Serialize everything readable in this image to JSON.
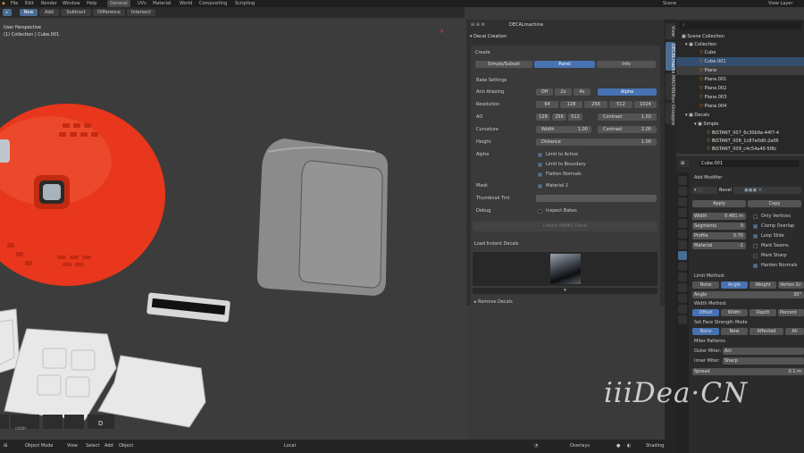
{
  "menu": [
    "File",
    "Edit",
    "Render",
    "Window",
    "Help"
  ],
  "workspaces": [
    "General",
    "UVs",
    "Material",
    "World",
    "Compositing",
    "Scripting"
  ],
  "scene_label": "Scene",
  "view_layer_label": "View Layer",
  "toolbar": {
    "new": "New",
    "add": "Add",
    "subtract": "Subtract",
    "difference": "Difference",
    "intersect": "Intersect"
  },
  "viewport": {
    "perspective": "User Perspective",
    "collection": "(1) Collection | Cube.001",
    "bottom_text": "cloth",
    "key_label": "D"
  },
  "bottombar": {
    "mode": "Object Mode",
    "view": "View",
    "select": "Select",
    "add": "Add",
    "object": "Object",
    "transform": "Local",
    "overlays": "Overlays",
    "shading": "Shading"
  },
  "npanel": {
    "header_title": "DECALmachine",
    "section_title": "Decal Creation",
    "create_label": "Create",
    "tabs": [
      "Simple/Subset",
      "Panel",
      "Info"
    ],
    "bake_title": "Bake Settings",
    "anti_aliasing": {
      "label": "Anti Aliasing",
      "options": [
        "Off",
        "2x",
        "4x",
        "Alpha"
      ]
    },
    "resolution": {
      "label": "Resolution",
      "options": [
        "64",
        "128",
        "256",
        "512",
        "1024"
      ]
    },
    "ao": {
      "label": "AO",
      "options": [
        "128",
        "256",
        "512"
      ],
      "contrast_label": "Contrast",
      "contrast": "1.50"
    },
    "curvature": {
      "label": "Curvature",
      "width_label": "Width",
      "width": "1.00",
      "contrast_label": "Contrast",
      "contrast": "2.00"
    },
    "height": {
      "label": "Height",
      "distance_label": "Distance",
      "distance": "1.00"
    },
    "alpha": {
      "label": "Alpha",
      "checks": [
        "Limit to Active",
        "Limit to Boundary",
        "Flatten Normals"
      ]
    },
    "mask": {
      "label": "Mask",
      "check": "Material 2"
    },
    "thumbnail_tint": "Thumbnail Tint",
    "debug": {
      "label": "Debug",
      "check": "Inspect Bakes"
    },
    "create_button": "Create PANEL Decal",
    "load_title": "Load Instant Decals",
    "remove_label": "Remove Decals"
  },
  "sidetabs": [
    "View",
    "DECALmachine",
    "MACHIN3tools",
    "Grouppro"
  ],
  "outliner": {
    "title": "Scene Collection",
    "rows": [
      "Collection",
      "Cube",
      "Cube.001",
      "Plane",
      "Plane.001",
      "Plane.002",
      "Plane.003",
      "Plane.004",
      "Decals",
      "Simple",
      "INSTANT_007_6c30b9a-44f7-4",
      "INSTANT_008_1c87e0d0-2a06",
      "INSTANT_009_c4c54a40-5f8c"
    ]
  },
  "properties": {
    "object_name": "Cube.001",
    "add_modifier": "Add Modifier",
    "modifier_name": "Bevel",
    "apply": "Apply",
    "copy": "Copy",
    "width_label": "Width",
    "width": "0.481 m",
    "segments_label": "Segments",
    "segments": "9",
    "profile_label": "Profile",
    "profile": "0.70",
    "material_label": "Material",
    "material": "-1",
    "only_vertices": "Only Vertices",
    "clamp_overlap": "Clamp Overlap",
    "loop_slide": "Loop Slide",
    "mark_seams": "Mark Seams",
    "mark_sharp": "Mark Sharp",
    "harden_normals": "Harden Normals",
    "limit_method": "Limit Method:",
    "limit_options": [
      "None",
      "Angle",
      "Weight",
      "Vertex Gr"
    ],
    "angle_label": "Angle",
    "angle": "30°",
    "width_method": "Width Method:",
    "width_options": [
      "Offset",
      "Width",
      "Depth",
      "Percent"
    ],
    "face_strength": "Set Face Strength Mode",
    "face_options": [
      "None",
      "New",
      "Affected",
      "All"
    ],
    "miter_patterns": "Miter Patterns",
    "outer_miter_label": "Outer Miter:",
    "outer_miter": "Arc",
    "inner_miter_label": "Inner Miter:",
    "inner_miter": "Sharp",
    "spread_label": "Spread",
    "spread": "0.1 m"
  },
  "watermark": "iiiDea·CN",
  "colors": {
    "accent": "#4772b3",
    "sphere": "#e8371c",
    "panel_bg": "#303030"
  }
}
